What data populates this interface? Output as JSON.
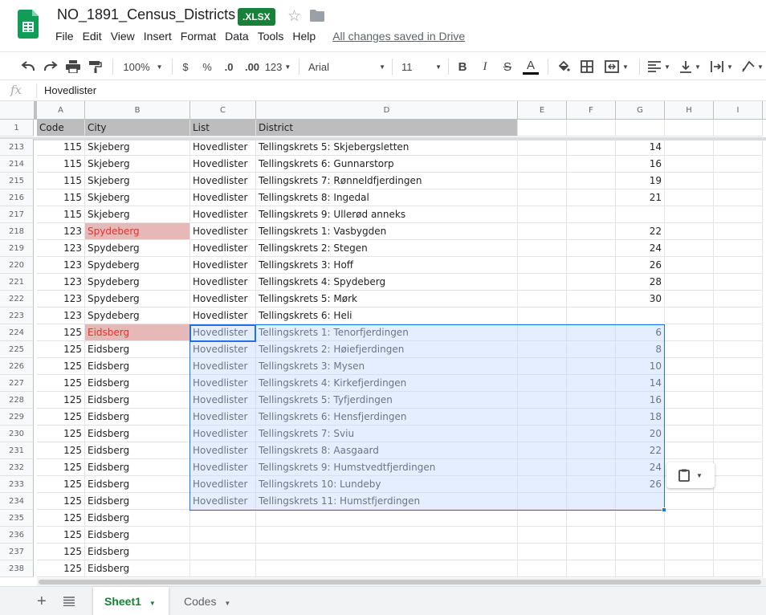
{
  "doc": {
    "title": "NO_1891_Census_Districts",
    "badge": ".XLSX",
    "saved_status": "All changes saved in Drive"
  },
  "menu": [
    "File",
    "Edit",
    "View",
    "Insert",
    "Format",
    "Data",
    "Tools",
    "Help"
  ],
  "toolbar": {
    "zoom": "100%",
    "currency": "$",
    "percent": "%",
    "decrease_decimal": ".0",
    "increase_decimal": ".00",
    "more_formats": "123",
    "font": "Arial",
    "font_size": "11",
    "bold": "B",
    "italic": "I",
    "strike": "S",
    "text_color": "A"
  },
  "formula_bar": {
    "fx": "fx",
    "value": "Hovedlister"
  },
  "columns": [
    "A",
    "B",
    "C",
    "D",
    "E",
    "F",
    "G",
    "H",
    "I"
  ],
  "header_row": {
    "num": "1",
    "cells": [
      "Code",
      "City",
      "List",
      "District"
    ]
  },
  "rows": [
    {
      "num": "213",
      "code": "115",
      "city": "Skjeberg",
      "list": "Hovedlister",
      "district": "Tellingskrets 5: Skjebergsletten",
      "g": "14",
      "dup": false
    },
    {
      "num": "214",
      "code": "115",
      "city": "Skjeberg",
      "list": "Hovedlister",
      "district": "Tellingskrets 6: Gunnarstorp",
      "g": "16",
      "dup": false
    },
    {
      "num": "215",
      "code": "115",
      "city": "Skjeberg",
      "list": "Hovedlister",
      "district": "Tellingskrets 7: Rønneldfjerdingen",
      "g": "19",
      "dup": false
    },
    {
      "num": "216",
      "code": "115",
      "city": "Skjeberg",
      "list": "Hovedlister",
      "district": "Tellingskrets 8: Ingedal",
      "g": "21",
      "dup": false
    },
    {
      "num": "217",
      "code": "115",
      "city": "Skjeberg",
      "list": "Hovedlister",
      "district": "Tellingskrets 9: Ullerød anneks",
      "g": "",
      "dup": false
    },
    {
      "num": "218",
      "code": "123",
      "city": "Spydeberg",
      "list": "Hovedlister",
      "district": "Tellingskrets 1: Vasbygden",
      "g": "22",
      "dup": true
    },
    {
      "num": "219",
      "code": "123",
      "city": "Spydeberg",
      "list": "Hovedlister",
      "district": "Tellingskrets 2: Stegen",
      "g": "24",
      "dup": false
    },
    {
      "num": "220",
      "code": "123",
      "city": "Spydeberg",
      "list": "Hovedlister",
      "district": "Tellingskrets 3: Hoff",
      "g": "26",
      "dup": false
    },
    {
      "num": "221",
      "code": "123",
      "city": "Spydeberg",
      "list": "Hovedlister",
      "district": "Tellingskrets 4: Spydeberg",
      "g": "28",
      "dup": false
    },
    {
      "num": "222",
      "code": "123",
      "city": "Spydeberg",
      "list": "Hovedlister",
      "district": "Tellingskrets 5: Mørk",
      "g": "30",
      "dup": false
    },
    {
      "num": "223",
      "code": "123",
      "city": "Spydeberg",
      "list": "Hovedlister",
      "district": "Tellingskrets 6: Heli",
      "g": "",
      "dup": false
    },
    {
      "num": "224",
      "code": "125",
      "city": "Eidsberg",
      "list": "Hovedlister",
      "district": "Tellingskrets 1: Tenorfjerdingen",
      "g": "6",
      "dup": true
    },
    {
      "num": "225",
      "code": "125",
      "city": "Eidsberg",
      "list": "Hovedlister",
      "district": "Tellingskrets 2: Høiefjerdingen",
      "g": "8",
      "dup": false
    },
    {
      "num": "226",
      "code": "125",
      "city": "Eidsberg",
      "list": "Hovedlister",
      "district": "Tellingskrets 3: Mysen",
      "g": "10",
      "dup": false
    },
    {
      "num": "227",
      "code": "125",
      "city": "Eidsberg",
      "list": "Hovedlister",
      "district": "Tellingskrets 4: Kirkefjerdingen",
      "g": "14",
      "dup": false
    },
    {
      "num": "228",
      "code": "125",
      "city": "Eidsberg",
      "list": "Hovedlister",
      "district": "Tellingskrets 5: Tyfjerdingen",
      "g": "16",
      "dup": false
    },
    {
      "num": "229",
      "code": "125",
      "city": "Eidsberg",
      "list": "Hovedlister",
      "district": "Tellingskrets 6: Hensfjerdingen",
      "g": "18",
      "dup": false
    },
    {
      "num": "230",
      "code": "125",
      "city": "Eidsberg",
      "list": "Hovedlister",
      "district": "Tellingskrets 7: Sviu",
      "g": "20",
      "dup": false
    },
    {
      "num": "231",
      "code": "125",
      "city": "Eidsberg",
      "list": "Hovedlister",
      "district": "Tellingskrets 8: Aasgaard",
      "g": "22",
      "dup": false
    },
    {
      "num": "232",
      "code": "125",
      "city": "Eidsberg",
      "list": "Hovedlister",
      "district": "Tellingskrets 9: Humstvedtfjerdingen",
      "g": "24",
      "dup": false
    },
    {
      "num": "233",
      "code": "125",
      "city": "Eidsberg",
      "list": "Hovedlister",
      "district": "Tellingskrets 10: Lundeby",
      "g": "26",
      "dup": false
    },
    {
      "num": "234",
      "code": "125",
      "city": "Eidsberg",
      "list": "Hovedlister",
      "district": "Tellingskrets 11: Humstfjerdingen",
      "g": "",
      "dup": false
    },
    {
      "num": "235",
      "code": "125",
      "city": "Eidsberg",
      "list": "",
      "district": "",
      "g": "",
      "dup": false
    },
    {
      "num": "236",
      "code": "125",
      "city": "Eidsberg",
      "list": "",
      "district": "",
      "g": "",
      "dup": false
    },
    {
      "num": "237",
      "code": "125",
      "city": "Eidsberg",
      "list": "",
      "district": "",
      "g": "",
      "dup": false
    },
    {
      "num": "238",
      "code": "125",
      "city": "Eidsberg",
      "list": "",
      "district": "",
      "g": "",
      "dup": false
    }
  ],
  "sheets": {
    "active": "Sheet1",
    "other": "Codes"
  },
  "colors": {
    "brand_green": "#188038",
    "selection": "#1a73e8",
    "duplicate_fill": "#e6b8b7",
    "duplicate_text": "#e8302a"
  }
}
